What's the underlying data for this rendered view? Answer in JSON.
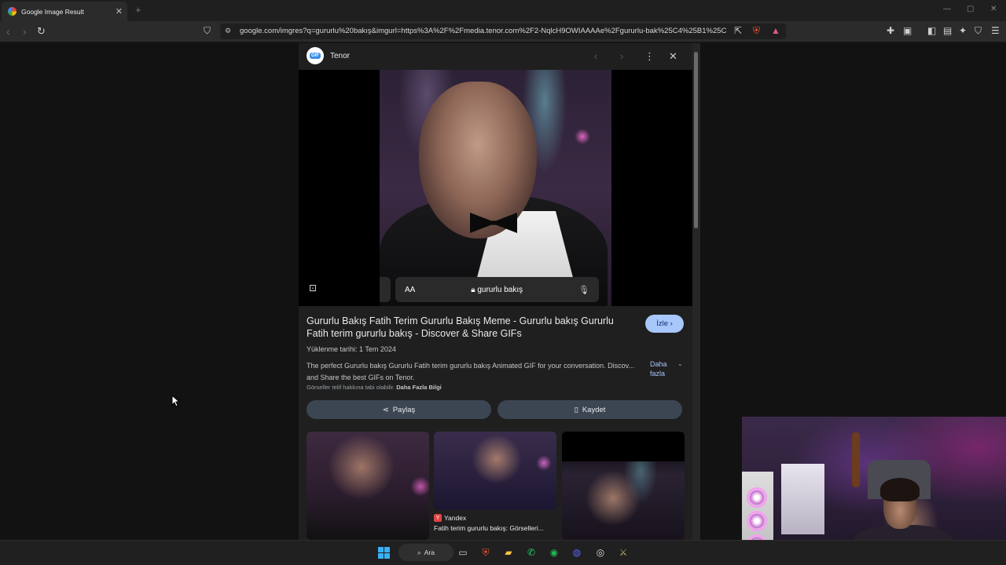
{
  "browser": {
    "tab_title": "Google Image Result",
    "tab_close": "✕",
    "new_tab": "+",
    "url": "google.com/imgres?q=gururlu%20bakış&imgurl=https%3A%2F%2Fmedia.tenor.com%2F2-NqlcH9OWIAAAAe%2Fgururlu-bak%25C4%25B1%25C5%...",
    "window_controls": [
      "—",
      "▢",
      "✕"
    ]
  },
  "panel": {
    "source_name": "Tenor",
    "source_logo_text": "GIF",
    "close": "✕",
    "more": "⋮",
    "prev": "‹",
    "next": "›",
    "image_overlay": {
      "aa_label": "AA",
      "search_query": "gururlu bakış"
    },
    "title": "Gururlu Bakış Fatih Terim Gururlu Bakış Meme - Gururlu bakış Gururlu Fatih terim gururlu bakış - Discover & Share GIFs",
    "watch_button": "İzle",
    "upload_date": "Yüklenme tarihi: 1 Tem 2024",
    "description": "The perfect Gururlu bakış Gururlu Fatih terim gururlu bakış Animated GIF for your conversation. Discov... and Share the best GIFs on Tenor.",
    "more_link": "Daha fazla",
    "copyright_text": "Görseller telif hakkına tabi olabilir.",
    "copyright_link": "Daha Fazla Bilgi",
    "share_button": "Paylaş",
    "save_button": "Kaydet",
    "related": [
      {
        "source": "",
        "caption": ""
      },
      {
        "source": "Yandex",
        "caption": "Fatih terim gururlu bakış: Görselleri..."
      },
      {
        "source": "",
        "caption": ""
      }
    ]
  },
  "taskbar": {
    "search_label": "Ara",
    "icons": [
      "windows-start-icon",
      "search-icon",
      "task-view-icon",
      "brave-icon",
      "file-explorer-icon",
      "whatsapp-icon",
      "spotify-icon",
      "discord-icon",
      "obs-icon",
      "league-icon"
    ]
  },
  "colors": {
    "accent": "#a8c7fa",
    "panel_bg": "#1f1f1f",
    "button_bg": "#3c4653"
  }
}
